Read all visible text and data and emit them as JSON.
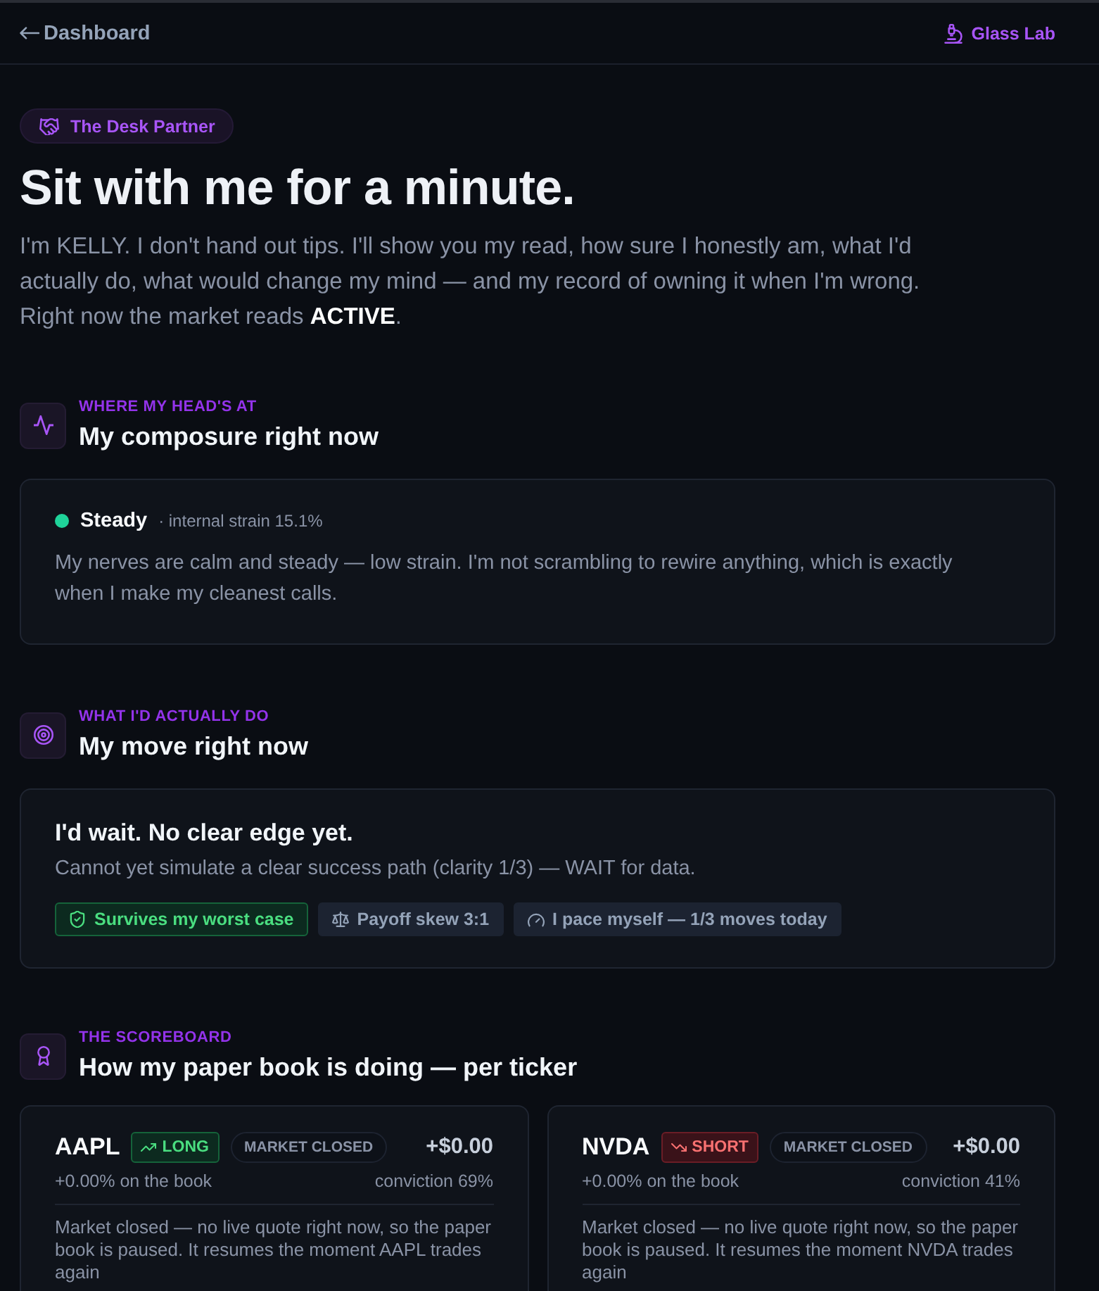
{
  "nav": {
    "back": {
      "label": "Dashboard"
    },
    "lab": {
      "label": "Glass Lab"
    }
  },
  "badge": {
    "label": "The Desk Partner"
  },
  "title": "Sit with me for a minute.",
  "intro": "I'm KELLY. I don't hand out tips. I'll show you my read, how sure I honestly am, what I'd actually do, what would change my mind — and my record of owning it when I'm wrong. Right now the market reads **ACTIVE**.",
  "composure": {
    "eyebrow": "WHERE MY HEAD'S AT",
    "title": "My composure right now",
    "state": {
      "label": "Steady",
      "color": "#1fd39a",
      "detail": "· internal strain 15.1%"
    },
    "text": "My nerves are calm and steady — low strain. I'm not scrambling to rewire anything, which is exactly when I make my cleanest calls."
  },
  "move": {
    "eyebrow": "WHAT I'D ACTUALLY DO",
    "title": "My move right now",
    "headline": "I'd wait. No clear edge yet.",
    "text": "Cannot yet simulate a clear success path (clarity 1/3) — WAIT for data.",
    "chips": [
      {
        "kind": "risk",
        "label": "Survives my worst case",
        "passed": true
      },
      {
        "kind": "skew",
        "label": "Payoff skew 3:1",
        "passed": false
      },
      {
        "kind": "pace",
        "label": "I pace myself — 1/3 moves today",
        "passed": false
      }
    ]
  },
  "scoreboard": {
    "eyebrow": "THE SCOREBOARD",
    "title": "How my paper book is doing — per ticker",
    "positions": [
      {
        "ticker": "AAPL",
        "kind": "long",
        "side_label": "LONG",
        "status": "MARKET CLOSED",
        "pnl": "+$0.00",
        "book_return": "+0.00% on the book",
        "conviction": "conviction 69%",
        "note": "Market closed — no live quote right now, so the paper book is paused. It resumes the moment AAPL trades again"
      },
      {
        "ticker": "NVDA",
        "kind": "short",
        "side_label": "SHORT",
        "status": "MARKET CLOSED",
        "pnl": "+$0.00",
        "book_return": "+0.00% on the book",
        "conviction": "conviction 41%",
        "note": "Market closed — no live quote right now, so the paper book is paused. It resumes the moment NVDA trades again"
      }
    ]
  }
}
